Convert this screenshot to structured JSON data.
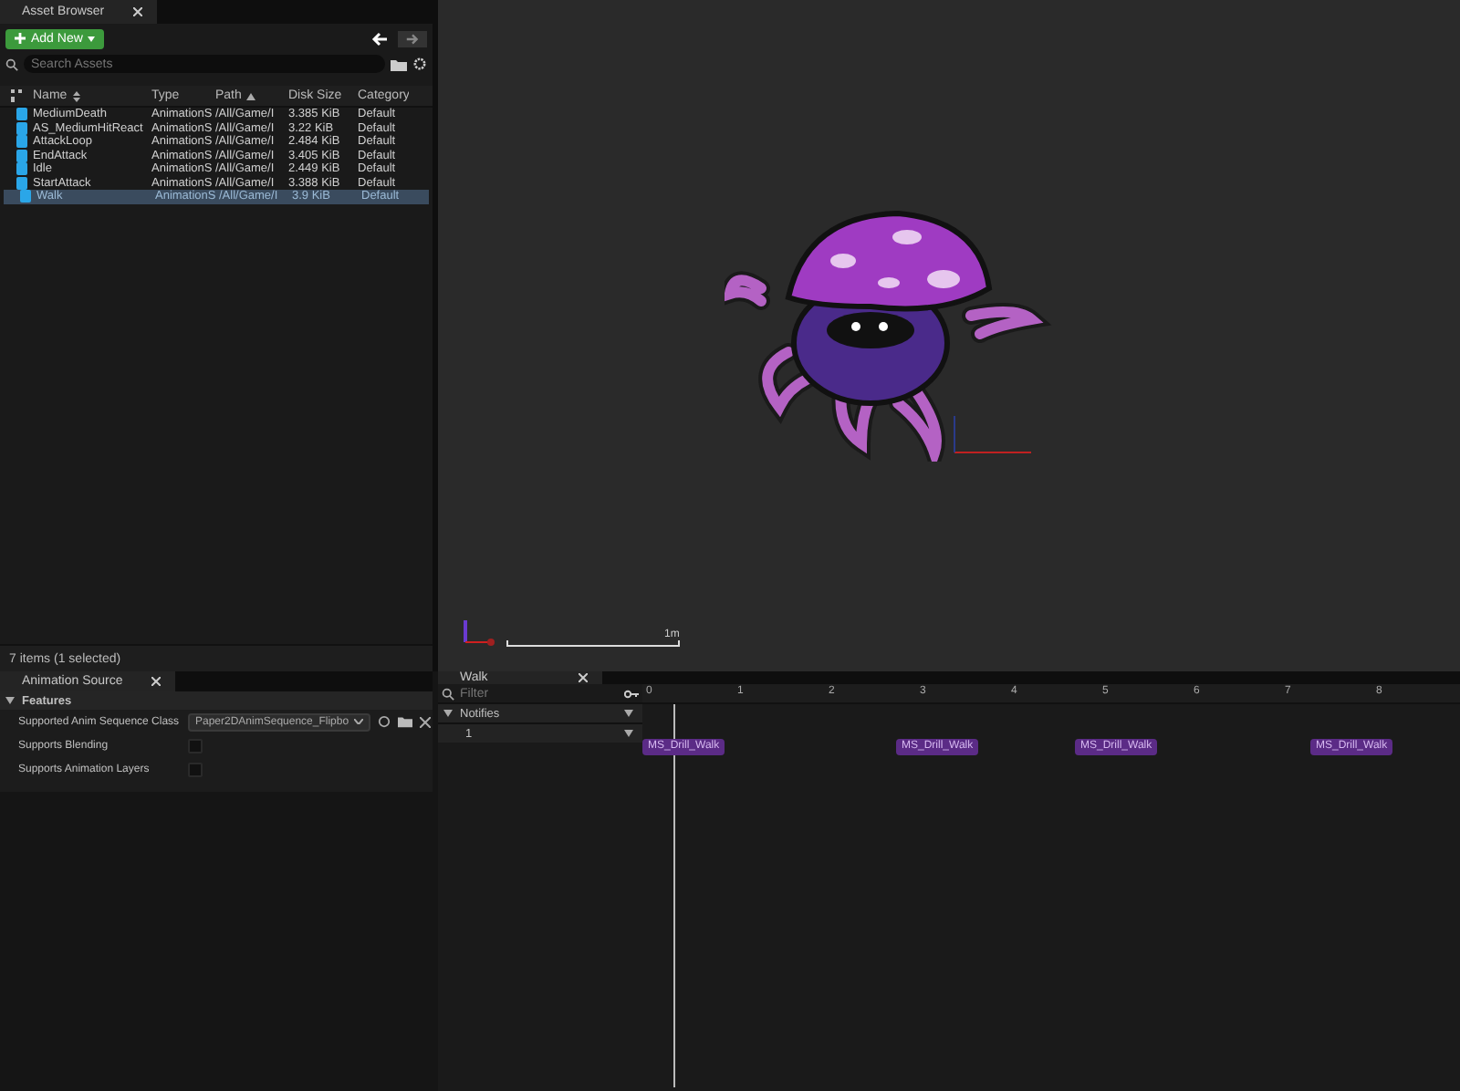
{
  "asset_browser": {
    "tab_title": "Asset Browser",
    "add_button": "Add New",
    "search": {
      "placeholder": "Search Assets"
    },
    "columns": [
      "Name",
      "Type",
      "Path",
      "Disk Size",
      "Category"
    ],
    "rows": [
      {
        "name": "MediumDeath",
        "type": "AnimationS",
        "path": "/All/Game/I",
        "size": "3.385 KiB",
        "category": "Default",
        "selected": false
      },
      {
        "name": "AS_MediumHitReact",
        "type": "AnimationS",
        "path": "/All/Game/I",
        "size": "3.22 KiB",
        "category": "Default",
        "selected": false
      },
      {
        "name": "AttackLoop",
        "type": "AnimationS",
        "path": "/All/Game/I",
        "size": "2.484 KiB",
        "category": "Default",
        "selected": false
      },
      {
        "name": "EndAttack",
        "type": "AnimationS",
        "path": "/All/Game/I",
        "size": "3.405 KiB",
        "category": "Default",
        "selected": false
      },
      {
        "name": "Idle",
        "type": "AnimationS",
        "path": "/All/Game/I",
        "size": "2.449 KiB",
        "category": "Default",
        "selected": false
      },
      {
        "name": "StartAttack",
        "type": "AnimationS",
        "path": "/All/Game/I",
        "size": "3.388 KiB",
        "category": "Default",
        "selected": false
      },
      {
        "name": "Walk",
        "type": "AnimationS",
        "path": "/All/Game/I",
        "size": "3.9 KiB",
        "category": "Default",
        "selected": true
      }
    ],
    "status": "7 items (1 selected)"
  },
  "viewport": {
    "scale_label": "1m"
  },
  "animation_source": {
    "tab_title": "Animation Source",
    "section": "Features",
    "properties": [
      {
        "label": "Supported Anim Sequence Class",
        "kind": "dropdown",
        "value": "Paper2DAnimSequence_Flipbo"
      },
      {
        "label": "Supports Blending",
        "kind": "checkbox",
        "checked": false
      },
      {
        "label": "Supports Animation Layers",
        "kind": "checkbox",
        "checked": false
      }
    ]
  },
  "timeline": {
    "tab_title": "Walk",
    "filter": {
      "placeholder": "Filter"
    },
    "tracks": [
      "Notifies",
      "1"
    ],
    "ticks": [
      "0",
      "1",
      "2",
      "3",
      "4",
      "5",
      "6",
      "7",
      "8"
    ],
    "notifies": [
      "MS_Drill_Walk",
      "MS_Drill_Walk",
      "MS_Drill_Walk",
      "MS_Drill_Walk"
    ]
  }
}
